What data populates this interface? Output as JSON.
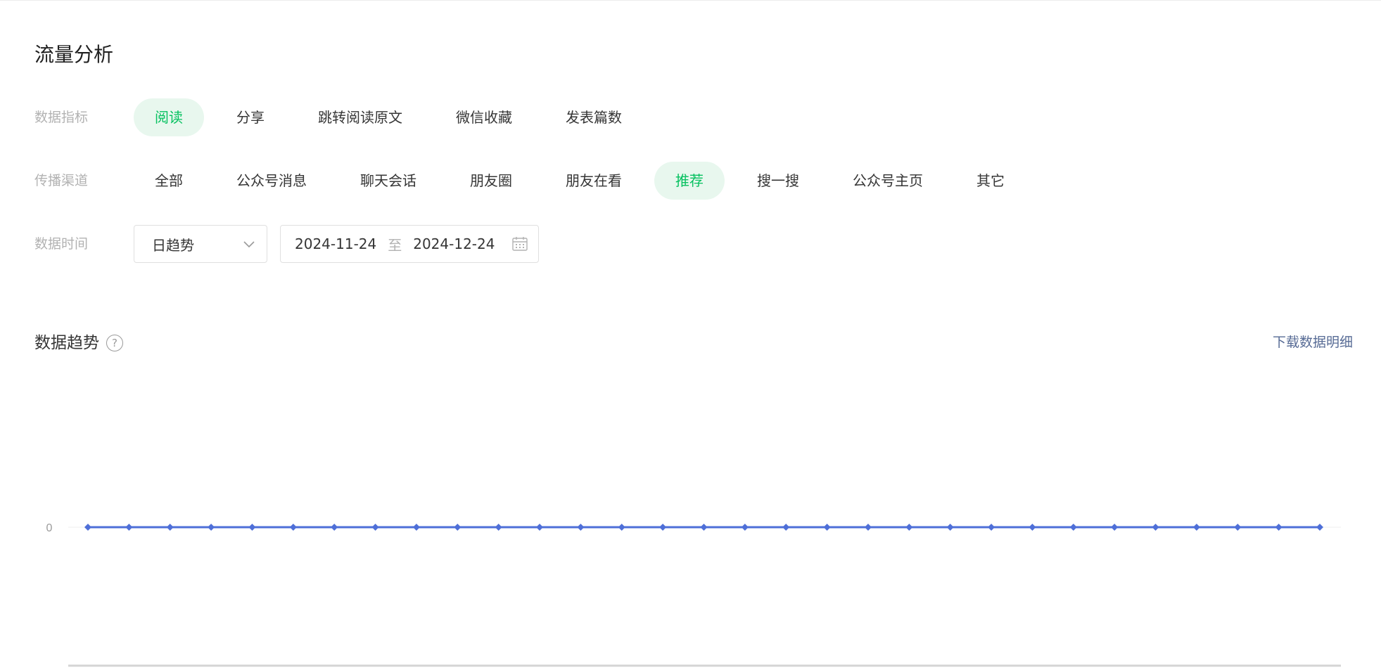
{
  "page": {
    "title": "流量分析"
  },
  "filters": {
    "metrics": {
      "label": "数据指标",
      "options": [
        "阅读",
        "分享",
        "跳转阅读原文",
        "微信收藏",
        "发表篇数"
      ],
      "selected": "阅读"
    },
    "channels": {
      "label": "传播渠道",
      "options": [
        "全部",
        "公众号消息",
        "聊天会话",
        "朋友圈",
        "朋友在看",
        "推荐",
        "搜一搜",
        "公众号主页",
        "其它"
      ],
      "selected": "推荐"
    },
    "time": {
      "label": "数据时间",
      "mode": "日趋势",
      "start": "2024-11-24",
      "separator": "至",
      "end": "2024-12-24"
    }
  },
  "trend": {
    "title": "数据趋势",
    "help_icon": "question-circle-icon",
    "download_label": "下载数据明细"
  },
  "colors": {
    "accent": "#07c160",
    "accent_bg": "#e8f7ee",
    "series": "#4e6fd8",
    "link": "#576b95"
  },
  "chart_data": {
    "type": "line",
    "y_ticks": [
      "0"
    ],
    "ylim": [
      0,
      0
    ],
    "grid": true,
    "series": [
      {
        "values": [
          0,
          0,
          0,
          0,
          0,
          0,
          0,
          0,
          0,
          0,
          0,
          0,
          0,
          0,
          0,
          0,
          0,
          0,
          0,
          0,
          0,
          0,
          0,
          0,
          0,
          0,
          0,
          0,
          0,
          0,
          0
        ]
      }
    ]
  }
}
